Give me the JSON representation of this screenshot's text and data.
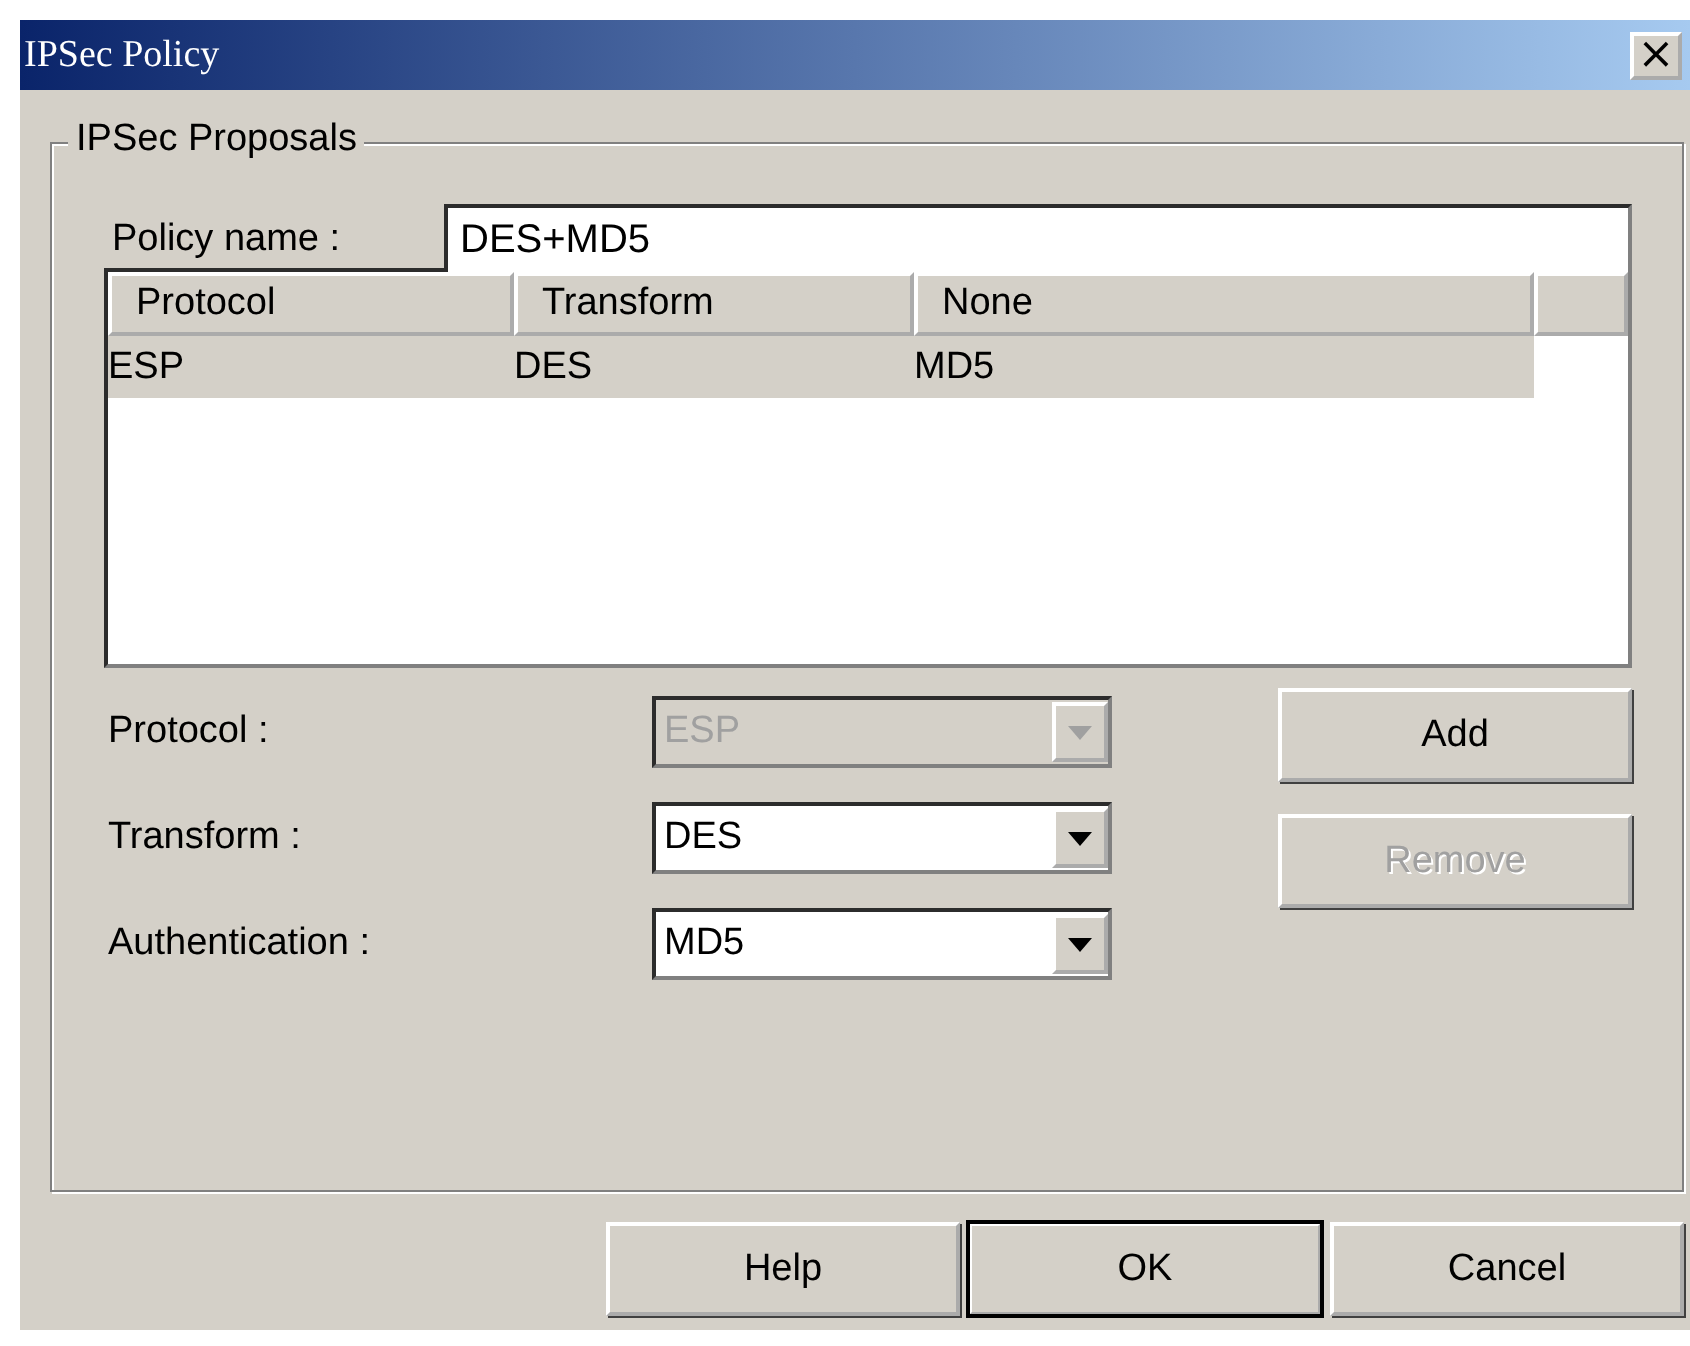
{
  "window": {
    "title": "IPSec Policy",
    "close": "×"
  },
  "group": {
    "title": "IPSec Proposals"
  },
  "policy_name": {
    "label": "Policy name :",
    "value": "DES+MD5"
  },
  "table": {
    "columns": [
      "Protocol",
      "Transform",
      "None"
    ],
    "rows": [
      {
        "cells": [
          "ESP",
          "DES",
          "MD5"
        ],
        "selected": true
      }
    ]
  },
  "fields": [
    {
      "label": "Protocol :",
      "value": "ESP",
      "disabled": true
    },
    {
      "label": "Transform :",
      "value": "DES",
      "disabled": false
    },
    {
      "label": "Authentication :",
      "value": "MD5",
      "disabled": false
    }
  ],
  "side_buttons": [
    {
      "label": "Add",
      "disabled": false
    },
    {
      "label": "Remove",
      "disabled": true
    }
  ],
  "buttons": [
    {
      "label": "Help",
      "default": false
    },
    {
      "label": "OK",
      "default": true
    },
    {
      "label": "Cancel",
      "default": false
    }
  ]
}
